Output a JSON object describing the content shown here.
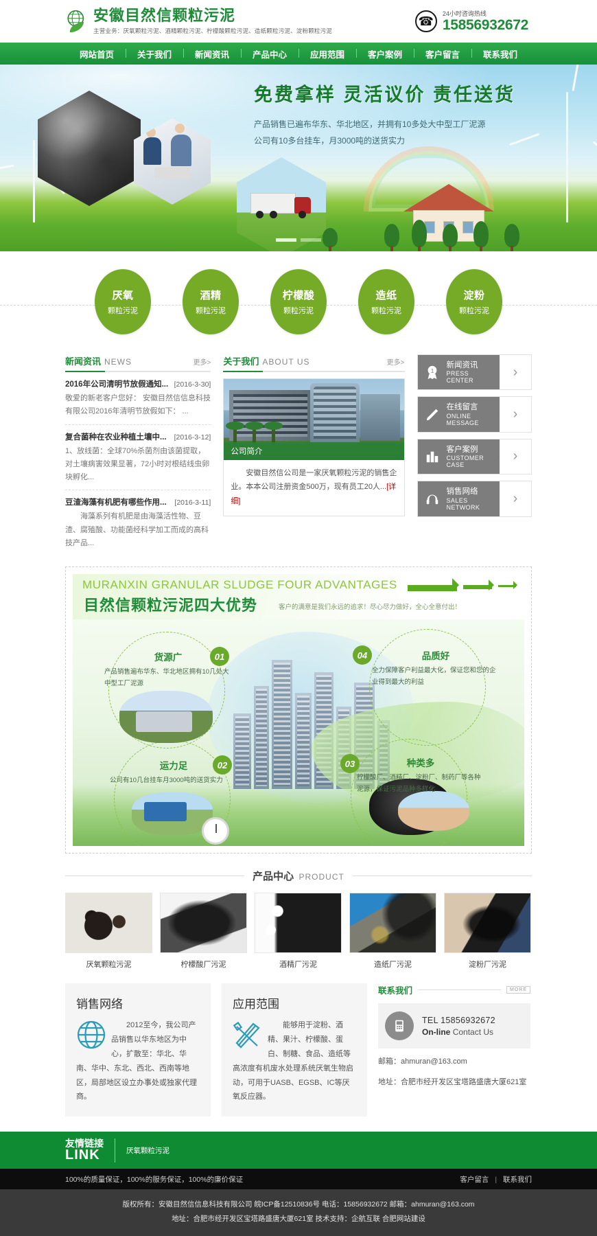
{
  "header": {
    "brand_title": "安徽目然信颗粒污泥",
    "brand_sub": "主营业务：厌氧颗粒污泥、酒精颗粒污泥、柠檬酸颗粒污泥、造纸颗粒污泥、淀粉颗粒污泥",
    "hotline_label": "24小时咨询热线",
    "hotline_number": "15856932672",
    "logo_icon": "globe-leaf-icon",
    "phone_icon": "phone-circle-icon"
  },
  "nav": {
    "items": [
      {
        "label": "网站首页"
      },
      {
        "label": "关于我们"
      },
      {
        "label": "新闻资讯"
      },
      {
        "label": "产品中心"
      },
      {
        "label": "应用范围"
      },
      {
        "label": "客户案例"
      },
      {
        "label": "客户留言"
      },
      {
        "label": "联系我们"
      }
    ]
  },
  "banner": {
    "headline": "免费拿样  灵活议价  责任送货",
    "line1": "产品销售已遍布华东、华北地区，并拥有10多处大中型工厂泥源",
    "line2": "公司有10多台挂车，月3000吨的送货实力"
  },
  "categories": [
    {
      "name": "厌氧",
      "sub": "颗粒污泥"
    },
    {
      "name": "酒精",
      "sub": "颗粒污泥"
    },
    {
      "name": "柠檬酸",
      "sub": "颗粒污泥"
    },
    {
      "name": "造纸",
      "sub": "颗粒污泥"
    },
    {
      "name": "淀粉",
      "sub": "颗粒污泥"
    }
  ],
  "news": {
    "title_cn": "新闻资讯",
    "title_en": "NEWS",
    "more": "更多>",
    "items": [
      {
        "title": "2016年公司清明节放假通知...",
        "date": "[2016-3-30]",
        "desc": "敬爱的新老客户您好：      安徽目然信信息科技有限公司2016年清明节放假如下：      ..."
      },
      {
        "title": "复合菌种在农业种植土壤中...",
        "date": "[2016-3-12]",
        "desc": "1、放线菌：全球70%杀菌剂由该菌提取，对土壤病害效果显著，72小时对根结线虫卵块孵化..."
      },
      {
        "title": "豆渣海藻有机肥有哪些作用...",
        "date": "[2016-3-11]",
        "desc": "　　海藻系列有机肥是由海藻活性物、豆渣、腐殖酸、功能菌经科学加工而成的高科技产品..."
      }
    ]
  },
  "about": {
    "title_cn": "关于我们",
    "title_en": "ABOUT US",
    "more": "更多>",
    "image_caption": "公司简介",
    "text": "　　安徽目然信公司是一家厌氧颗粒污泥的销售企业。本本公司注册资金500万，现有员工20人...",
    "more_link": "[详细]"
  },
  "quicklinks": [
    {
      "cn": "新闻资讯",
      "en": "PRESS CENTER",
      "icon": "medal-icon",
      "glyph": "①"
    },
    {
      "cn": "在线留言",
      "en": "ONLINE MESSAGE",
      "icon": "pencil-icon",
      "glyph": "✎"
    },
    {
      "cn": "客户案例",
      "en": "CUSTOMER CASE",
      "icon": "building-icon",
      "glyph": "Ἶ2"
    },
    {
      "cn": "销售网络",
      "en": "SALES NETWORK",
      "icon": "headset-icon",
      "glyph": "☺"
    }
  ],
  "advantages": {
    "title_en": "MURANXIN GRANULAR SLUDGE FOUR ADVANTAGES",
    "title_cn": "目然信颗粒污泥四大优势",
    "slogan": "客户的满意是我们永远的追求！尽心尽力做好，全心全意付出！",
    "items": [
      {
        "num": "01",
        "name": "货源广",
        "desc": "产品销售遍布华东、华北地区拥有10几处大中型工厂泥源"
      },
      {
        "num": "02",
        "name": "运力足",
        "desc": "公司有10几台挂车月3000吨的送货实力"
      },
      {
        "num": "03",
        "name": "种类多",
        "desc": "柠檬酸厂、酒精厂、淀粉厂、制药厂等各种泥源，保证污泥品种多样化"
      },
      {
        "num": "04",
        "name": "品质好",
        "desc": "全力保障客户利益最大化，保证您和您的企业得到最大的利益"
      }
    ]
  },
  "products": {
    "title_cn": "产品中心",
    "title_en": "PRODUCT",
    "items": [
      {
        "caption": "厌氧颗粒污泥"
      },
      {
        "caption": "柠檬酸厂污泥"
      },
      {
        "caption": "酒精厂污泥"
      },
      {
        "caption": "造纸厂污泥"
      },
      {
        "caption": "淀粉厂污泥"
      }
    ]
  },
  "sales_network": {
    "title": "销售网络",
    "icon": "globe-icon",
    "text": "　　2012至今，我公司产品销售以华东地区为中心，扩散至：华北、华南、华中、东北、西北、西南等地区，局部地区设立办事处或独家代理商。"
  },
  "application": {
    "title": "应用范围",
    "icon": "tools-icon",
    "text": "　　能够用于淀粉、酒精、果汁、柠檬酸、蛋白、制糖、食品、造纸等高浓度有机废水处理系统厌氧生物启动，可用于UASB、EGSB、IC等厌氧反应器。"
  },
  "contact": {
    "title": "联系我们",
    "more": "MORE",
    "icon": "telephone-icon",
    "tel_label": "TEL",
    "tel": "15856932672",
    "online": "On-line",
    "online_sub": "Contact Us",
    "email": "邮箱：ahmuran@163.com",
    "address": "地址：合肥市经开发区宝塔路盛唐大厦621室"
  },
  "friendlinks": {
    "cn": "友情链接",
    "en": "LINK",
    "items": "厌氧颗粒污泥"
  },
  "footer": {
    "slogan": "100%的质量保证，100%的服务保证，100%的廉价保证",
    "link1": "客户留言",
    "link2": "联系我们",
    "copyright": "版权所有：安徽目然信信息科技有限公司 皖ICP备12510836号 电话：15856932672 邮箱：ahmuran@163.com",
    "address_line": "地址：合肥市经开发区宝塔路盛唐大厦621室 技术支持：企航互联 合肥网站建设"
  },
  "colors": {
    "brand_green": "#1e8c39",
    "nav_green": "#17903a",
    "circle_green": "#76ab27",
    "accent_light": "#8cc63f"
  }
}
